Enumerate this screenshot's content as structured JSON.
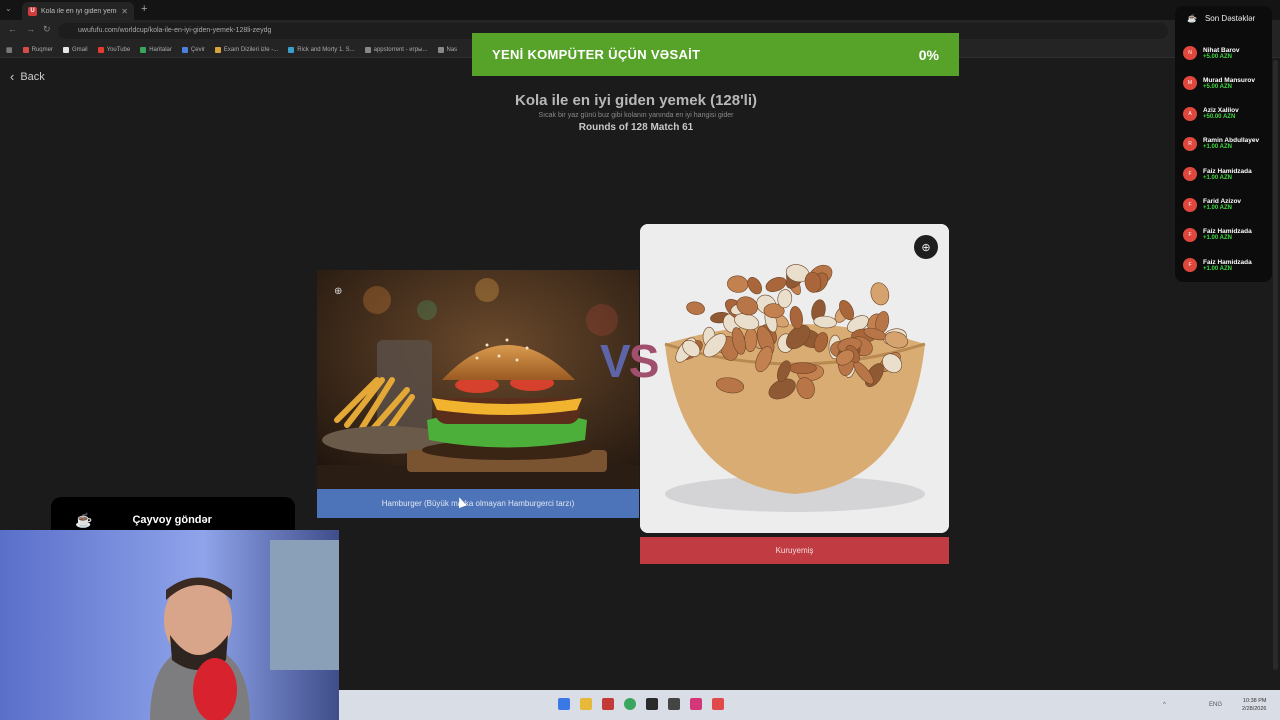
{
  "browser": {
    "tab_title": "Kola ile en iyi giden yemek (12…",
    "tab_favicon": "U",
    "new_tab": "+",
    "url": "uwufufu.com/worldcup/kola-ile-en-iyi-giden-yemek-128li-zeydg",
    "bookmarks": [
      {
        "label": "Ruqmer",
        "color": "#d94b4b"
      },
      {
        "label": "Gmail",
        "color": "#e6e6e6"
      },
      {
        "label": "YouTube",
        "color": "#e33b2e"
      },
      {
        "label": "Haritalar",
        "color": "#3aa55c"
      },
      {
        "label": "Çevir",
        "color": "#4b7fe0"
      },
      {
        "label": "Exam Dizileri izle -...",
        "color": "#d8a33b"
      },
      {
        "label": "Rick and Morty 1. S...",
        "color": "#3aa0c9"
      },
      {
        "label": "appstorrent - игры...",
        "color": "#888888"
      },
      {
        "label": "Nas",
        "color": "#888888"
      }
    ]
  },
  "page": {
    "back_label": "Back",
    "title": "Kola ile en iyi giden yemek (128'li)",
    "subtitle": "Sıcak bir yaz günü buz gibi kolanın yanında en iyi hangisi gider",
    "round": "Rounds of 128 Match 61",
    "vs_v": "V",
    "vs_s": "S",
    "left_option": "Hamburger (Büyük marka olmayan Hamburgerci tarzı)",
    "right_option": "Kuruyemiş",
    "left_color": "#4d74b8",
    "right_color": "#c13b42"
  },
  "banner": {
    "title": "YENİ KOMPÜTER ÜÇÜN VƏSAİT",
    "progress_label": "0%",
    "progress": 0,
    "color": "#57a32a"
  },
  "supporters": {
    "heading": "Son Dəstəklər",
    "items": [
      {
        "initial": "N",
        "name": "Nihat Barov",
        "amount": "+5.00 AZN"
      },
      {
        "initial": "M",
        "name": "Murad Mansurov",
        "amount": "+5.00 AZN"
      },
      {
        "initial": "A",
        "name": "Aziz Xalilov",
        "amount": "+50.00 AZN"
      },
      {
        "initial": "R",
        "name": "Ramin Abdullayev",
        "amount": "+1.00 AZN"
      },
      {
        "initial": "F",
        "name": "Faiz Hamidzada",
        "amount": "+1.00 AZN"
      },
      {
        "initial": "F",
        "name": "Farid Azizov",
        "amount": "+1.00 AZN"
      },
      {
        "initial": "F",
        "name": "Faiz Hamidzada",
        "amount": "+1.00 AZN"
      },
      {
        "initial": "F",
        "name": "Faiz Hamidzada",
        "amount": "+1.00 AZN"
      }
    ]
  },
  "chay": {
    "label": "Çayvoy göndər",
    "icon": "cup-icon"
  },
  "taskbar": {
    "lang": "ENG",
    "time": "10:38 PM",
    "date": "2/28/2026"
  }
}
